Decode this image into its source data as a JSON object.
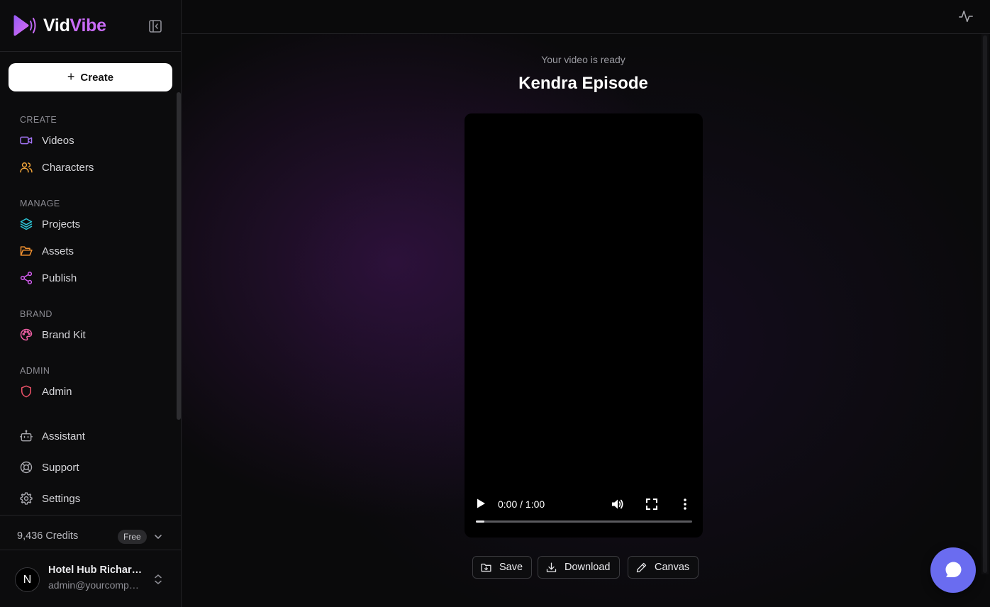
{
  "app": {
    "brand_part1": "Vid",
    "brand_part2": "Vibe",
    "accent_color": "#c86bf5"
  },
  "sidebar": {
    "create_button": "Create",
    "sections": [
      {
        "label": "CREATE",
        "items": [
          {
            "label": "Videos",
            "icon": "video-camera-icon",
            "color": "#a374f5"
          },
          {
            "label": "Characters",
            "icon": "users-icon",
            "color": "#f0a43a"
          }
        ]
      },
      {
        "label": "MANAGE",
        "items": [
          {
            "label": "Projects",
            "icon": "layers-icon",
            "color": "#2cc5d6"
          },
          {
            "label": "Assets",
            "icon": "folder-open-icon",
            "color": "#f2912f"
          },
          {
            "label": "Publish",
            "icon": "share-icon",
            "color": "#d45df0"
          }
        ]
      },
      {
        "label": "BRAND",
        "items": [
          {
            "label": "Brand Kit",
            "icon": "palette-icon",
            "color": "#f05fa4"
          }
        ]
      },
      {
        "label": "ADMIN",
        "items": [
          {
            "label": "Admin",
            "icon": "shield-icon",
            "color": "#f0536a"
          }
        ]
      }
    ],
    "footer_items": [
      {
        "label": "Assistant",
        "icon": "bot-icon"
      },
      {
        "label": "Support",
        "icon": "life-buoy-icon"
      },
      {
        "label": "Settings",
        "icon": "gear-icon"
      }
    ],
    "credits": "9,436 Credits",
    "plan_badge": "Free",
    "user": {
      "avatar_letter": "N",
      "name": "Hotel Hub Richardson",
      "email": "admin@yourcompany.com"
    }
  },
  "main": {
    "status_text": "Your video is ready",
    "title": "Kendra Episode",
    "player": {
      "time": "0:00 / 1:00",
      "progress_fraction": 0.04
    },
    "actions": {
      "save": "Save",
      "download": "Download",
      "canvas": "Canvas"
    }
  }
}
